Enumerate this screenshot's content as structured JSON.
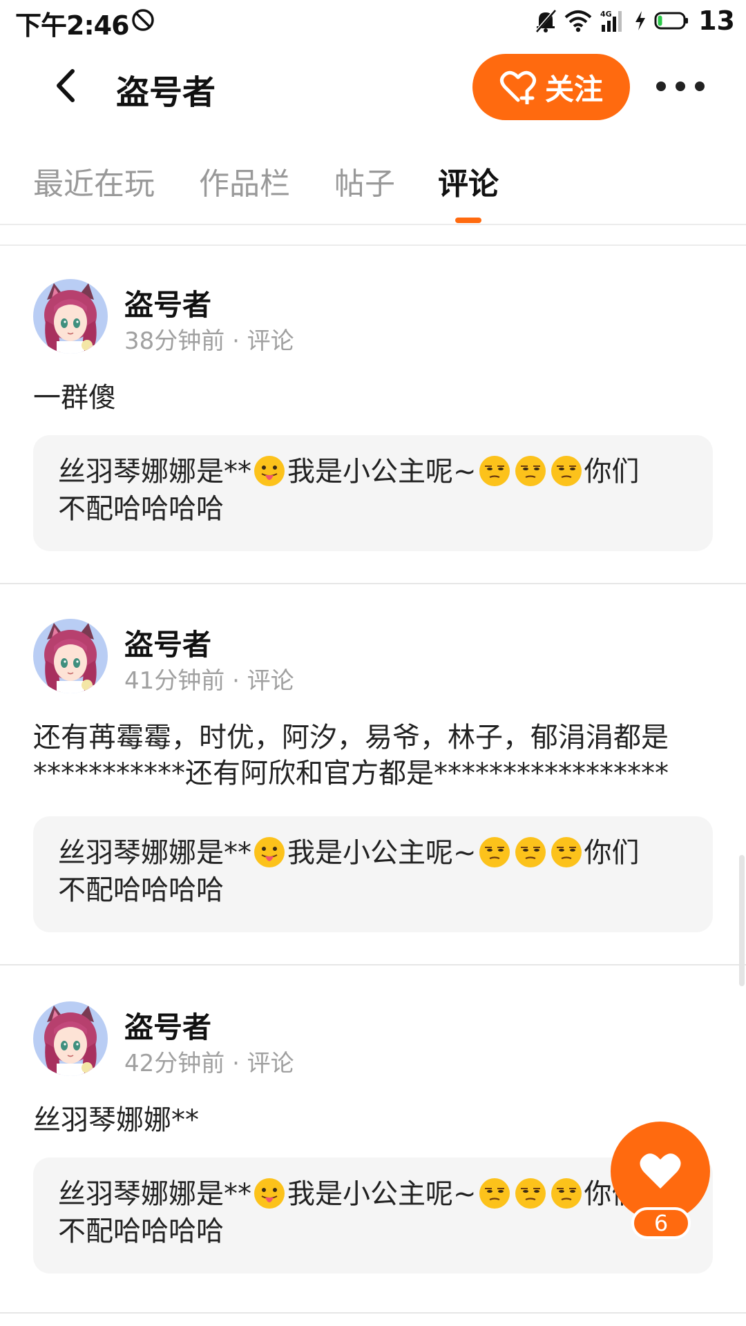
{
  "status_bar": {
    "time": "下午2:46",
    "battery": "13",
    "network": "4G"
  },
  "header": {
    "title": "盗号者",
    "follow_label": "关注"
  },
  "tabs": [
    {
      "label": "最近在玩",
      "active": false
    },
    {
      "label": "作品栏",
      "active": false
    },
    {
      "label": "帖子",
      "active": false
    },
    {
      "label": "评论",
      "active": true
    }
  ],
  "posts": [
    {
      "author": "盗号者",
      "meta": "38分钟前 · 评论",
      "body_lines": [
        "一群傻"
      ],
      "quote": {
        "before": "丝羽琴娜娜是**",
        "middle": "我是小公主呢~",
        "after": "你们",
        "line2": "不配哈哈哈哈"
      }
    },
    {
      "author": "盗号者",
      "meta": "41分钟前 · 评论",
      "body_lines": [
        "还有苒霉霉，时优，阿汐，易爷，林子，郁涓涓都是",
        "***********还有阿欣和官方都是*****************"
      ],
      "quote": {
        "before": "丝羽琴娜娜是**",
        "middle": "我是小公主呢~",
        "after": "你们",
        "line2": "不配哈哈哈哈"
      }
    },
    {
      "author": "盗号者",
      "meta": "42分钟前 · 评论",
      "body_lines": [
        "丝羽琴娜娜**"
      ],
      "quote": {
        "before": "丝羽琴娜娜是**",
        "middle": "我是小公主呢~",
        "after": "你们",
        "line2": "不配哈哈哈哈"
      }
    }
  ],
  "float_like": {
    "count": "6"
  },
  "colors": {
    "accent": "#ff6a0f",
    "quote_bg": "#f5f5f5",
    "meta": "#a0a0a0"
  },
  "icons": {
    "back": "chevron-left-icon",
    "follow": "heart-plus-icon",
    "more": "more-dots-icon",
    "like": "heart-icon",
    "tongue_emoji": "tongue-face-emoji",
    "unamused_emoji": "unamused-face-emoji"
  }
}
